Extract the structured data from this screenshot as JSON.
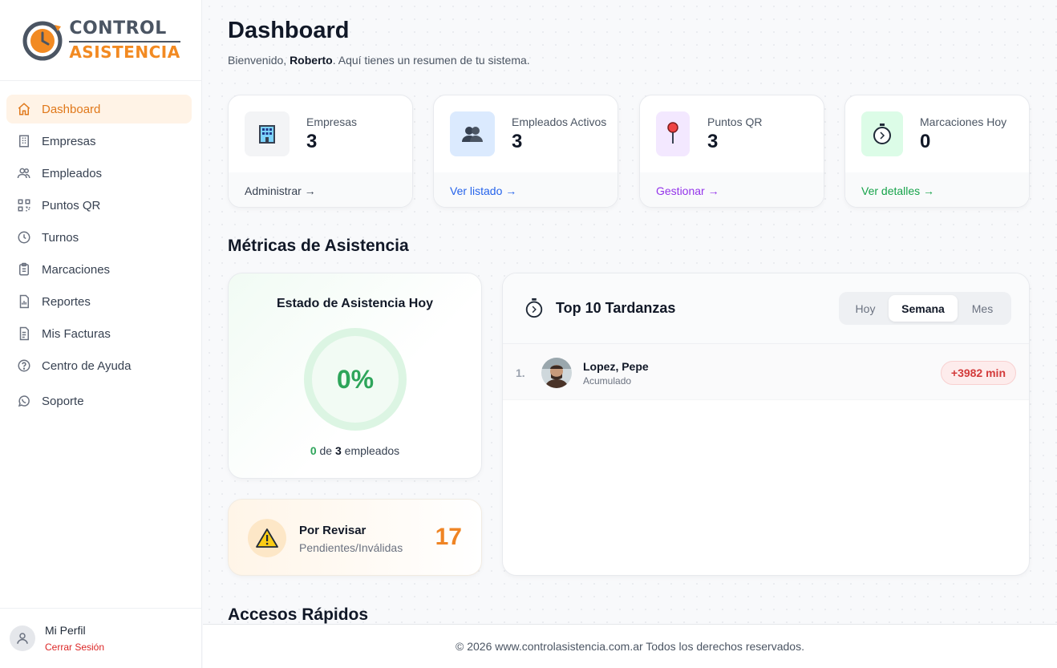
{
  "brand": {
    "line1": "CONTROL",
    "line2": "ASISTENCIA",
    "accent": "#f28a22"
  },
  "sidebar": {
    "items": [
      {
        "label": "Dashboard",
        "icon": "home-icon",
        "active": true
      },
      {
        "label": "Empresas",
        "icon": "building-icon"
      },
      {
        "label": "Empleados",
        "icon": "users-icon"
      },
      {
        "label": "Puntos QR",
        "icon": "qr-icon"
      },
      {
        "label": "Turnos",
        "icon": "clock-icon"
      },
      {
        "label": "Marcaciones",
        "icon": "clipboard-icon"
      },
      {
        "label": "Reportes",
        "icon": "report-icon"
      },
      {
        "label": "Mis Facturas",
        "icon": "invoice-icon"
      },
      {
        "label": "Centro de Ayuda",
        "icon": "help-icon"
      },
      {
        "label": "Soporte",
        "icon": "whatsapp-icon"
      }
    ],
    "profile": {
      "name": "Mi Perfil",
      "logout": "Cerrar Sesión"
    }
  },
  "header": {
    "title": "Dashboard",
    "welcome_prefix": "Bienvenido, ",
    "user": "Roberto",
    "welcome_suffix": ". Aquí tienes un resumen de tu sistema."
  },
  "stats": [
    {
      "label": "Empresas",
      "value": "3",
      "link": "Administrar →",
      "icon": "office-building-icon",
      "link_color": "#374151",
      "icon_bg": "#f3f4f6"
    },
    {
      "label": "Empleados Activos",
      "value": "3",
      "link": "Ver listado →",
      "icon": "people-icon",
      "link_color": "#2563eb",
      "icon_bg": "#dbeafe"
    },
    {
      "label": "Puntos QR",
      "value": "3",
      "link": "Gestionar →",
      "icon": "pin-icon",
      "link_color": "#9333ea",
      "icon_bg": "#f3e8ff"
    },
    {
      "label": "Marcaciones Hoy",
      "value": "0",
      "link": "Ver detalles →",
      "icon": "stopwatch-icon",
      "link_color": "#16a34a",
      "icon_bg": "#dcfce7"
    }
  ],
  "metrics": {
    "title": "Métricas de Asistencia",
    "attendance": {
      "title": "Estado de Asistencia Hoy",
      "percent": "0%",
      "present": "0",
      "of": " de ",
      "total": "3",
      "suffix": " empleados"
    },
    "review": {
      "title": "Por Revisar",
      "subtitle": "Pendientes/Inválidas",
      "count": "17"
    },
    "late": {
      "title": "Top 10 Tardanzas",
      "tabs": [
        "Hoy",
        "Semana",
        "Mes"
      ],
      "selected_tab": "Semana",
      "rows": [
        {
          "rank": "1.",
          "name": "Lopez, Pepe",
          "sub": "Acumulado",
          "minutes": "+3982 min"
        }
      ]
    }
  },
  "quick_access": {
    "title": "Accesos Rápidos"
  },
  "footer": {
    "text": "© 2026 www.controlasistencia.com.ar Todos los derechos reservados."
  }
}
